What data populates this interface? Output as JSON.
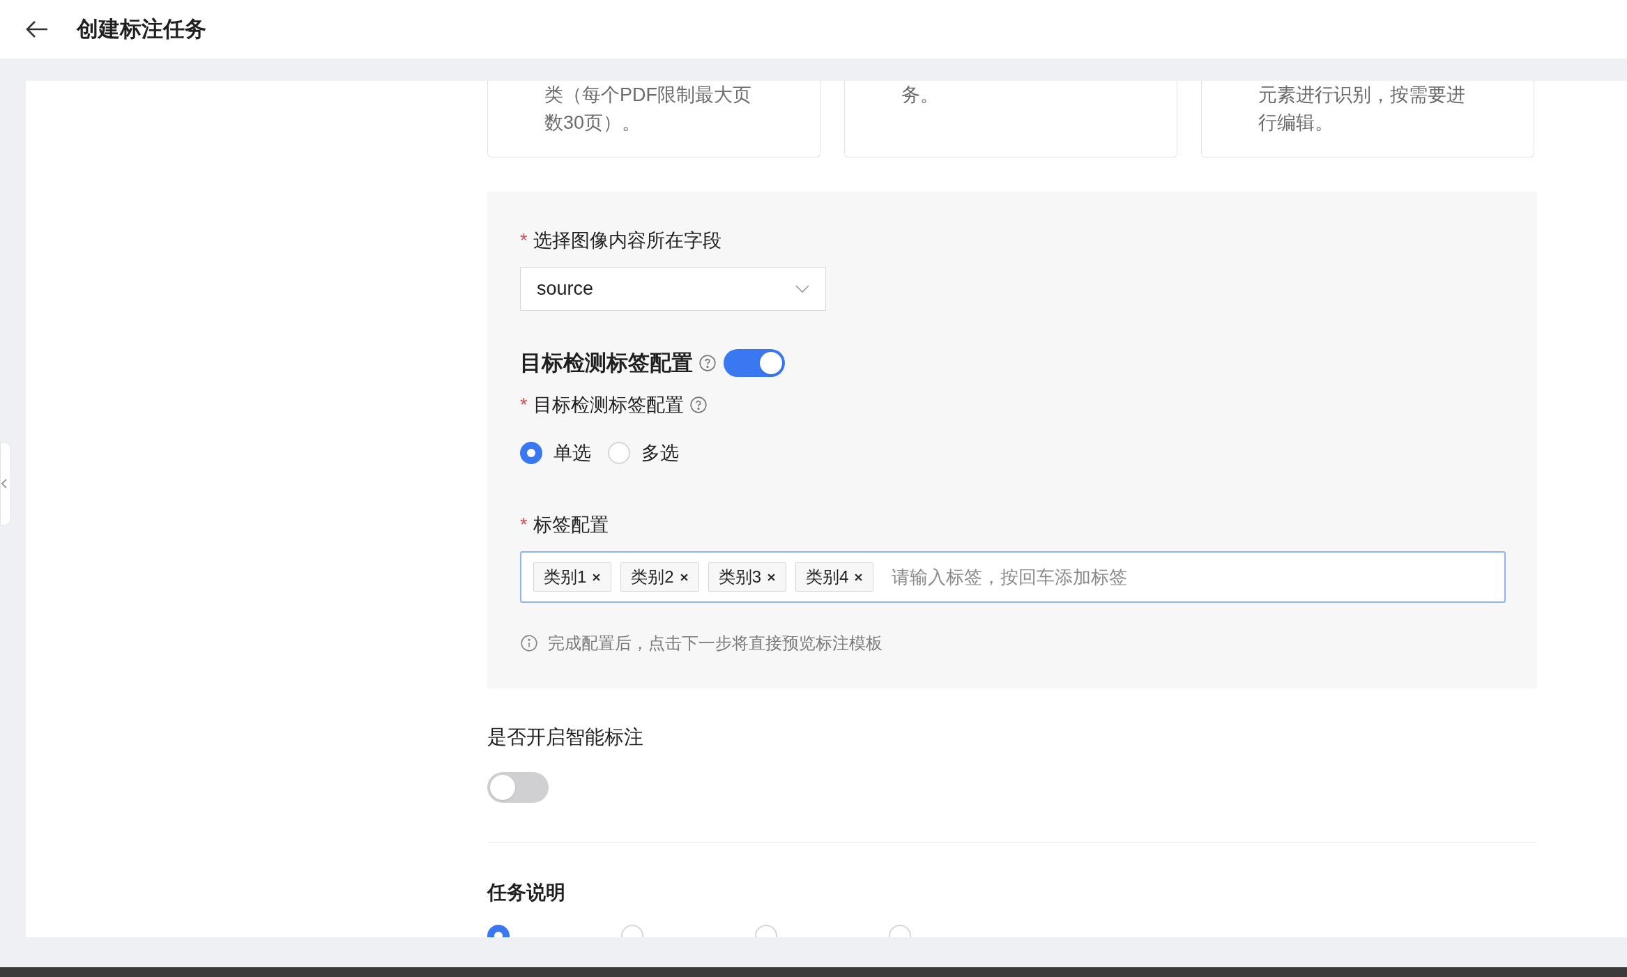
{
  "header": {
    "title": "创建标注任务"
  },
  "cards": [
    {
      "lines": [
        "类（每个PDF限制最大页",
        "数30页）。"
      ]
    },
    {
      "lines": [
        "务。"
      ]
    },
    {
      "lines": [
        "元素进行识别，按需要进",
        "行编辑。"
      ]
    }
  ],
  "image_field": {
    "label": "选择图像内容所在字段",
    "required_mark": "*",
    "value": "source"
  },
  "detection": {
    "title": "目标检测标签配置",
    "on": true,
    "mode_label": "目标检测标签配置",
    "mode_required_mark": "*",
    "modes": [
      {
        "label": "单选",
        "selected": true
      },
      {
        "label": "多选",
        "selected": false
      }
    ],
    "tags_label": "标签配置",
    "tags_required_mark": "*",
    "tags": [
      "类别1",
      "类别2",
      "类别3",
      "类别4"
    ],
    "placeholder": "请输入标签，按回车添加标签",
    "hint": "完成配置后，点击下一步将直接预览标注模板"
  },
  "smart": {
    "label": "是否开启智能标注",
    "on": false
  },
  "task": {
    "title": "任务说明",
    "options": [
      {
        "selected": true
      },
      {
        "selected": false
      },
      {
        "selected": false
      },
      {
        "selected": false
      }
    ]
  }
}
